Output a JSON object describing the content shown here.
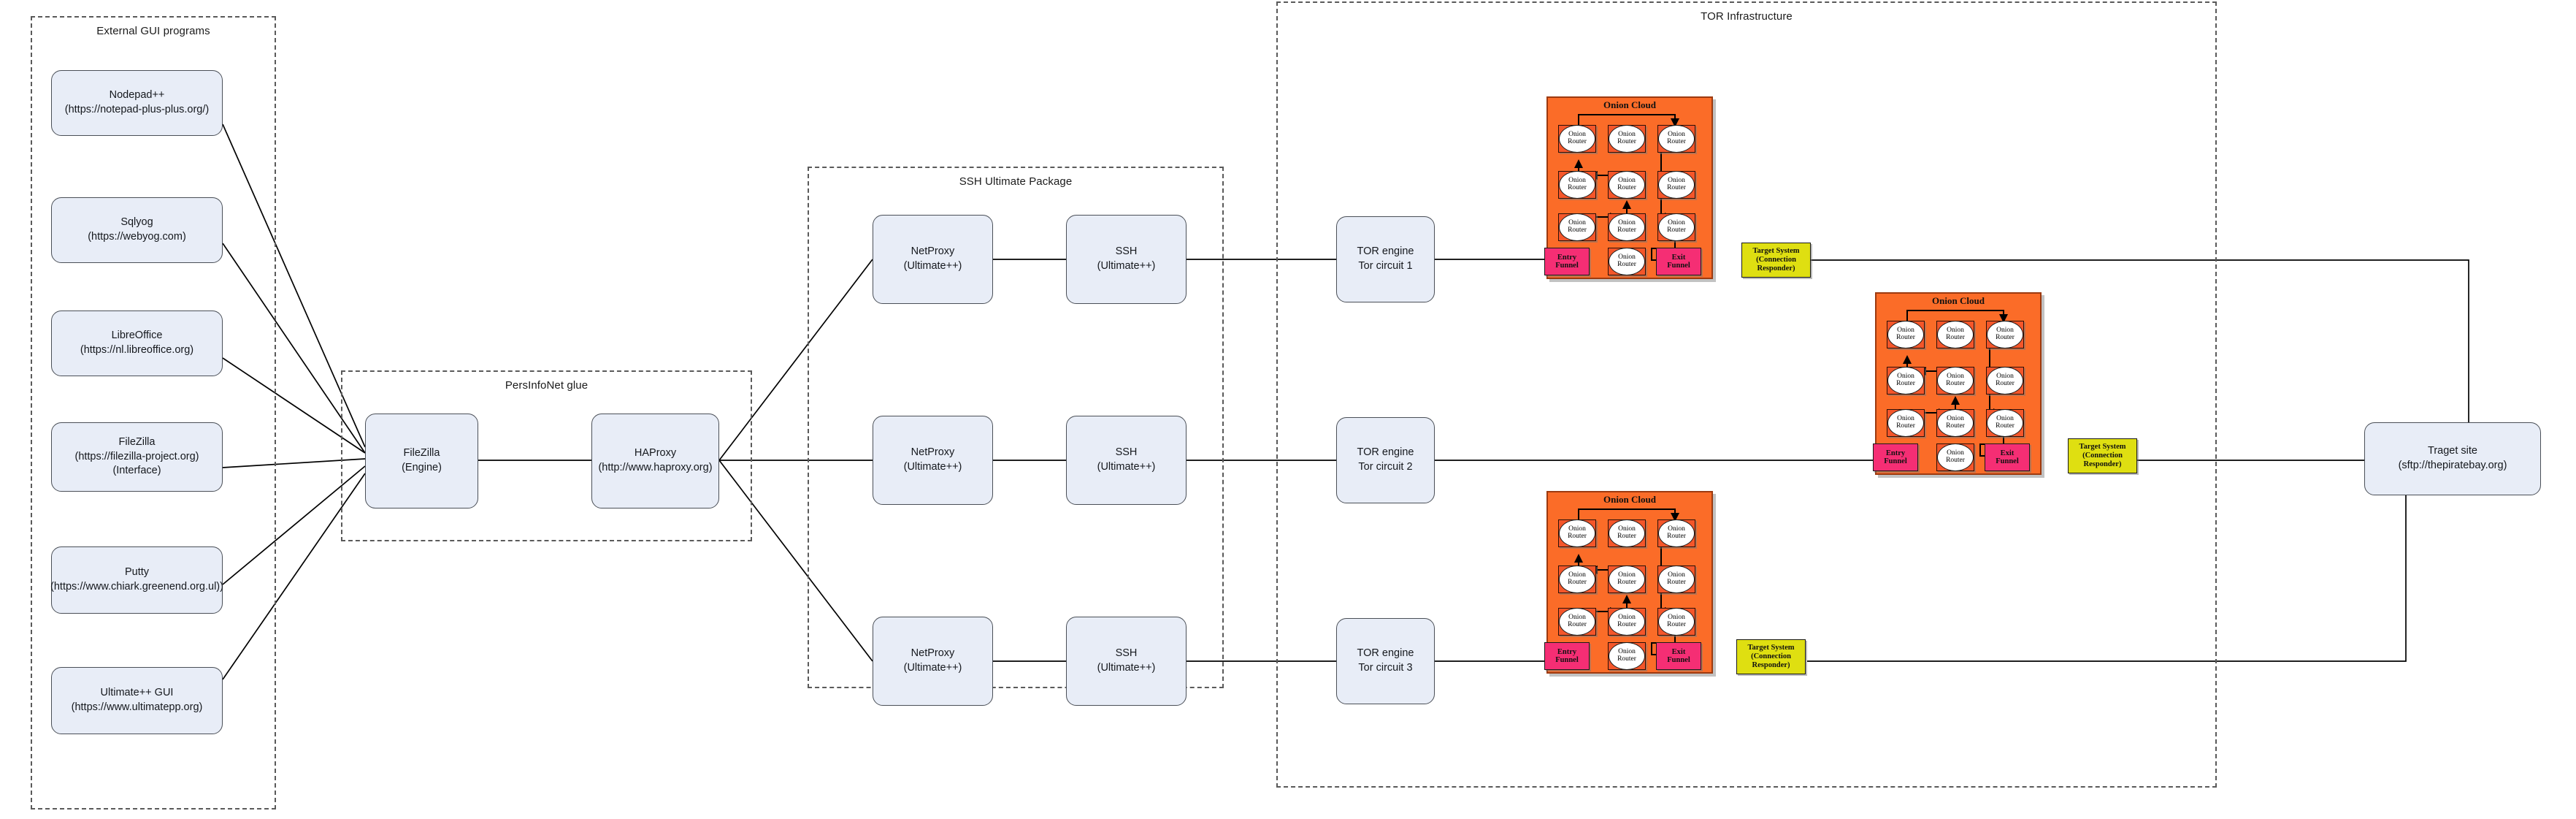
{
  "groups": {
    "external": {
      "title": "External GUI programs"
    },
    "glue": {
      "title": "PersInfoNet glue"
    },
    "ssh": {
      "title": "SSH Ultimate Package"
    },
    "tor": {
      "title": "TOR Infrastructure"
    }
  },
  "external_programs": [
    {
      "name": "Nodepad++",
      "url": "(https://notepad-plus-plus.org/)"
    },
    {
      "name": "Sqlyog",
      "url": "(https://webyog.com)"
    },
    {
      "name": "LibreOffice",
      "url": "(https://nl.libreoffice.org)"
    },
    {
      "name": "FileZilla",
      "url": "(https://filezilla-project.org)",
      "role": "(Interface)"
    },
    {
      "name": "Putty",
      "url": "(https://www.chiark.greenend.org.ul))"
    },
    {
      "name": "Ultimate++ GUI",
      "url": "(https://www.ultimatepp.org)"
    }
  ],
  "glue_nodes": [
    {
      "name": "FileZilla",
      "sub": "(Engine)"
    },
    {
      "name": "HAProxy",
      "sub": "(http://www.haproxy.org)"
    }
  ],
  "ssh_rows": [
    {
      "proxy": "NetProxy",
      "proxy_sub": "(Ultimate++)",
      "ssh": "SSH",
      "ssh_sub": "(Ultimate++)"
    },
    {
      "proxy": "NetProxy",
      "proxy_sub": "(Ultimate++)",
      "ssh": "SSH",
      "ssh_sub": "(Ultimate++)"
    },
    {
      "proxy": "NetProxy",
      "proxy_sub": "(Ultimate++)",
      "ssh": "SSH",
      "ssh_sub": "(Ultimate++)"
    }
  ],
  "tor_engines": [
    {
      "name": "TOR engine",
      "circuit": "Tor circuit 1"
    },
    {
      "name": "TOR engine",
      "circuit": "Tor circuit 2"
    },
    {
      "name": "TOR engine",
      "circuit": "Tor circuit 3"
    }
  ],
  "cloud": {
    "title": "Onion Cloud",
    "router_line1": "Onion",
    "router_line2": "Router",
    "entry_line1": "Entry",
    "entry_line2": "Funnel",
    "exit_line1": "Exit",
    "exit_line2": "Funnel",
    "router_count": 10
  },
  "target_system": {
    "line1": "Target System",
    "line2": "(Connection",
    "line3": "Responder)"
  },
  "target_site": {
    "name": "Traget site",
    "url": "(sftp://thepiratebay.org)"
  },
  "colors": {
    "node_fill": "#e8edf7",
    "node_border": "#4a4f57",
    "cloud_fill": "#fb6c28",
    "router_fill": "#f4562a",
    "funnel_fill": "#f52e74",
    "target_fill": "#dfdf11",
    "group_border": "#5a5a5a",
    "line": "#000000"
  }
}
